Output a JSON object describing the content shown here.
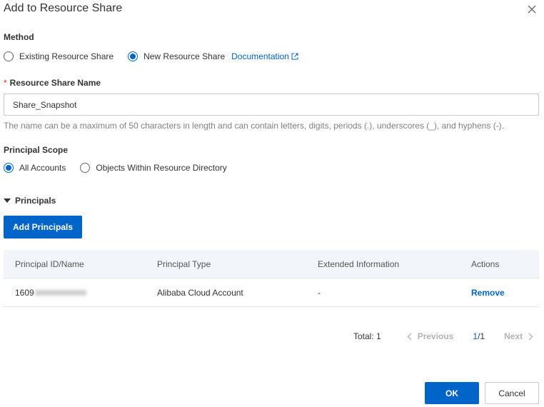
{
  "dialog": {
    "title": "Add to Resource Share"
  },
  "method": {
    "label": "Method",
    "options": [
      "Existing Resource Share",
      "New Resource Share"
    ],
    "selected": "New Resource Share",
    "doc_link": "Documentation"
  },
  "share_name": {
    "label": "Resource Share Name",
    "required_mark": "*",
    "value": "Share_Snapshot",
    "help": "The name can be a maximum of 50 characters in length and can contain letters, digits, periods (.), underscores (_), and hyphens (-)."
  },
  "principal_scope": {
    "label": "Principal Scope",
    "options": [
      "All Accounts",
      "Objects Within Resource Directory"
    ],
    "selected": "All Accounts"
  },
  "principals": {
    "section_label": "Principals",
    "add_button": "Add Principals",
    "columns": [
      "Principal ID/Name",
      "Principal Type",
      "Extended Information",
      "Actions"
    ],
    "rows": [
      {
        "id_prefix": "1609",
        "type": "Alibaba Cloud Account",
        "extended": "-",
        "action": "Remove"
      }
    ]
  },
  "pagination": {
    "total": "Total: 1",
    "previous": "Previous",
    "current": "1",
    "separator": "/1",
    "next": "Next"
  },
  "footer": {
    "ok": "OK",
    "cancel": "Cancel"
  },
  "colors": {
    "primary": "#0064c8",
    "required": "#d93026",
    "header_bg": "#f2f5f9"
  }
}
